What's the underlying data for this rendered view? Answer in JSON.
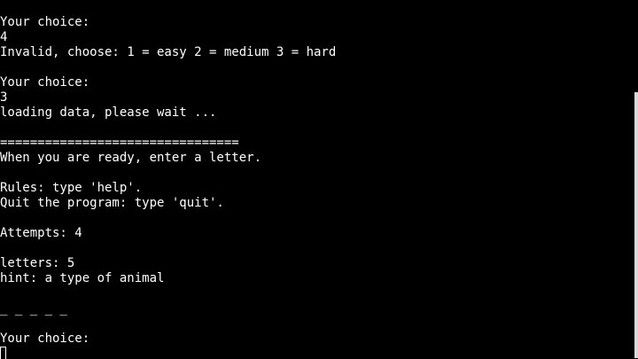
{
  "terminal": {
    "lines": [
      "Your choice:",
      "4",
      "Invalid, choose: 1 = easy 2 = medium 3 = hard",
      "",
      "Your choice:",
      "3",
      "loading data, please wait ...",
      "",
      "================================",
      "When you are ready, enter a letter.",
      "",
      "Rules: type 'help'.",
      "Quit the program: type 'quit'.",
      "",
      "Attempts: 4",
      "",
      "letters: 5",
      "hint: a type of animal",
      "",
      "_ _ _ _ _",
      "",
      "Your choice:"
    ],
    "input_value": ""
  }
}
